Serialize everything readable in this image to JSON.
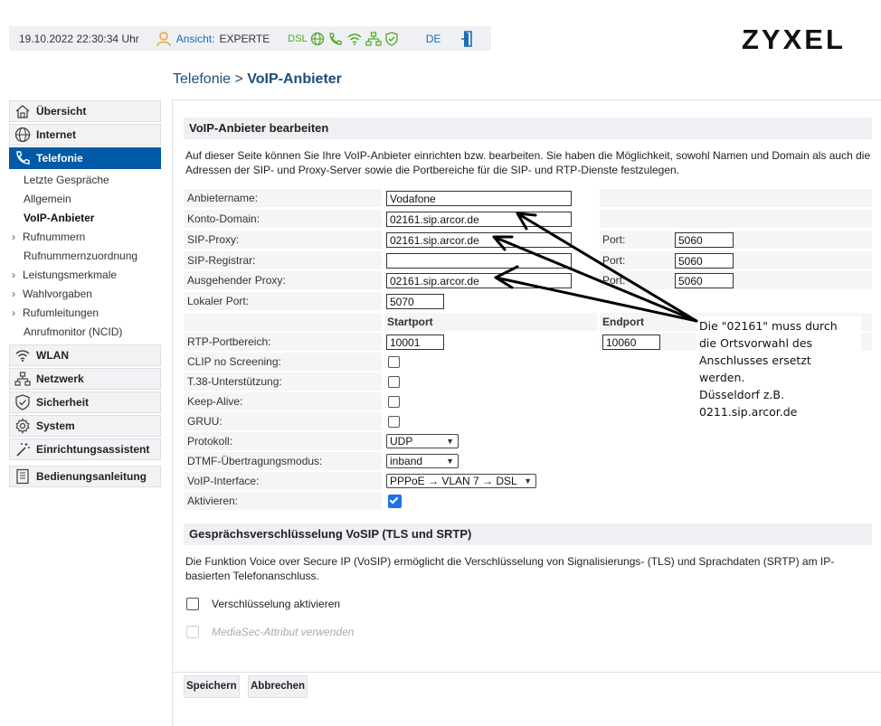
{
  "header": {
    "datetime": "19.10.2022 22:30:34 Uhr",
    "view_label": "Ansicht:",
    "view_value": "EXPERTE",
    "dsl_label": "DSL",
    "language": "DE",
    "brand": "ZYXEL"
  },
  "breadcrumb": {
    "parent": "Telefonie",
    "separator": ">",
    "current": "VoIP-Anbieter"
  },
  "sidebar": {
    "main": [
      {
        "label": "Übersicht",
        "icon": "home-icon"
      },
      {
        "label": "Internet",
        "icon": "globe-icon"
      },
      {
        "label": "Telefonie",
        "icon": "phone-icon",
        "active": true
      }
    ],
    "sub": [
      {
        "label": "Letzte Gespräche"
      },
      {
        "label": "Allgemein"
      },
      {
        "label": "VoIP-Anbieter",
        "current": true
      },
      {
        "label": "Rufnummern",
        "expandable": true
      },
      {
        "label": "Rufnummernzuordnung"
      },
      {
        "label": "Leistungsmerkmale",
        "expandable": true
      },
      {
        "label": "Wahlvorgaben",
        "expandable": true
      },
      {
        "label": "Rufumleitungen",
        "expandable": true
      },
      {
        "label": "Anrufmonitor (NCID)"
      }
    ],
    "main2": [
      {
        "label": "WLAN",
        "icon": "wifi-icon"
      },
      {
        "label": "Netzwerk",
        "icon": "network-icon"
      },
      {
        "label": "Sicherheit",
        "icon": "shield-icon"
      },
      {
        "label": "System",
        "icon": "gear-icon"
      },
      {
        "label": "Einrichtungsassistent",
        "icon": "wand-icon"
      }
    ],
    "manual": {
      "label": "Bedienungsanleitung",
      "icon": "book-icon"
    }
  },
  "section1": {
    "title": "VoIP-Anbieter bearbeiten",
    "description": "Auf dieser Seite können Sie Ihre VoIP-Anbieter einrichten bzw. bearbeiten. Sie haben die Möglichkeit, sowohl Namen und Domain als auch die Adressen der SIP- und Proxy-Server sowie die Portbereiche für die SIP- und RTP-Dienste festzulegen."
  },
  "form": {
    "anbietername": {
      "label": "Anbietername:",
      "value": "Vodafone"
    },
    "konto_domain": {
      "label": "Konto-Domain:",
      "value": "02161.sip.arcor.de"
    },
    "sip_proxy": {
      "label": "SIP-Proxy:",
      "value": "02161.sip.arcor.de",
      "port_label": "Port:",
      "port": "5060"
    },
    "sip_registrar": {
      "label": "SIP-Registrar:",
      "value": "",
      "port_label": "Port:",
      "port": "5060"
    },
    "outbound_proxy": {
      "label": "Ausgehender Proxy:",
      "value": "02161.sip.arcor.de",
      "port_label": "Port:",
      "port": "5060"
    },
    "lokaler_port": {
      "label": "Lokaler Port:",
      "value": "5070"
    },
    "startport_head": "Startport",
    "endport_head": "Endport",
    "rtp": {
      "label": "RTP-Portbereich:",
      "start": "10001",
      "end": "10060"
    },
    "clip": {
      "label": "CLIP no Screening:",
      "checked": false
    },
    "t38": {
      "label": "T.38-Unterstützung:",
      "checked": false
    },
    "keepalive": {
      "label": "Keep-Alive:",
      "checked": false
    },
    "gruu": {
      "label": "GRUU:",
      "checked": false
    },
    "protokoll": {
      "label": "Protokoll:",
      "value": "UDP"
    },
    "dtmf": {
      "label": "DTMF-Übertragungsmodus:",
      "value": "inband"
    },
    "interface": {
      "label": "VoIP-Interface:",
      "value": "PPPoE → VLAN 7 → DSL"
    },
    "aktivieren": {
      "label": "Aktivieren:",
      "checked": true
    }
  },
  "note": {
    "lines": [
      "Die \"02161\" muss durch",
      "die Ortsvorwahl des",
      "Anschlusses ersetzt",
      "werden.",
      "Düsseldorf z.B.",
      "0211.sip.arcor.de"
    ]
  },
  "section2": {
    "title": "Gesprächsverschlüsselung VoSIP (TLS und SRTP)",
    "description": "Die Funktion Voice over Secure IP (VoSIP) ermöglicht die Verschlüsselung von Signalisierungs- (TLS) und Sprachdaten (SRTP) am IP-basierten Telefonanschluss.",
    "encrypt_label": "Verschlüsselung aktivieren",
    "mediasec_label": "MediaSec-Attribut verwenden"
  },
  "buttons": {
    "save": "Speichern",
    "cancel": "Abbrechen"
  },
  "colors": {
    "accent": "#005aa5",
    "dsl_green": "#4ca81e",
    "link": "#1b6fb5"
  }
}
